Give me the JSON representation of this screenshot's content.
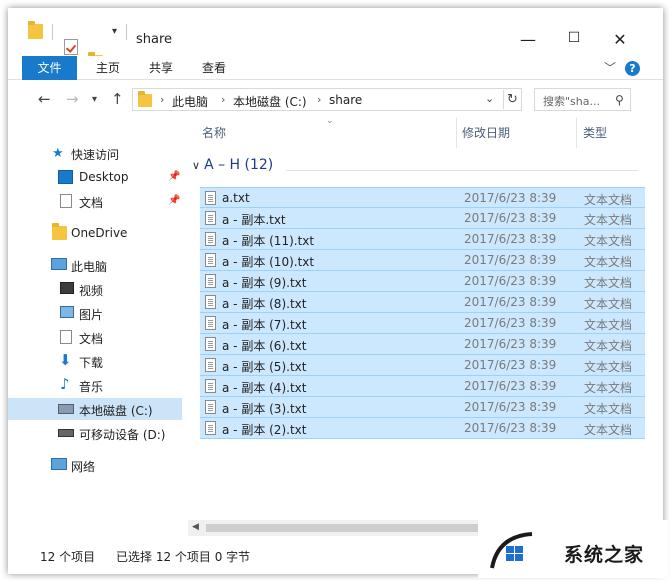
{
  "window": {
    "title": "share",
    "minimize_glyph": "—",
    "maximize_glyph": "☐",
    "close_glyph": "✕"
  },
  "ribbon": {
    "tabs": [
      {
        "label": "文件"
      },
      {
        "label": "主页"
      },
      {
        "label": "共享"
      },
      {
        "label": "查看"
      }
    ],
    "help_glyph": "?"
  },
  "address": {
    "crumbs": [
      "此电脑",
      "本地磁盘 (C:)",
      "share"
    ],
    "search_placeholder": "搜索\"sha...",
    "icons": {
      "back": "arrow-left-icon",
      "forward": "arrow-right-icon",
      "up": "arrow-up-icon",
      "refresh": "refresh-icon",
      "search": "search-icon"
    }
  },
  "sidebar": {
    "items": [
      {
        "label": "快速访问",
        "icon": "star-icon"
      },
      {
        "label": "Desktop",
        "icon": "desktop-icon",
        "pinned": true
      },
      {
        "label": "文档",
        "icon": "document-icon",
        "pinned": true
      },
      {
        "label": "OneDrive",
        "icon": "folder-icon"
      },
      {
        "label": "此电脑",
        "icon": "computer-icon"
      },
      {
        "label": "视频",
        "icon": "video-icon"
      },
      {
        "label": "图片",
        "icon": "picture-icon"
      },
      {
        "label": "文档",
        "icon": "document-icon"
      },
      {
        "label": "下载",
        "icon": "download-icon"
      },
      {
        "label": "音乐",
        "icon": "music-icon"
      },
      {
        "label": "本地磁盘 (C:)",
        "icon": "drive-icon",
        "selected": true
      },
      {
        "label": "可移动设备 (D:)",
        "icon": "removable-drive-icon"
      },
      {
        "label": "网络",
        "icon": "network-icon"
      }
    ]
  },
  "columns": {
    "name": "名称",
    "date": "修改日期",
    "type": "类型"
  },
  "group": {
    "title": "A – H (12)"
  },
  "files": [
    {
      "name": "a.txt",
      "date": "2017/6/23 8:39",
      "type": "文本文档"
    },
    {
      "name": "a - 副本.txt",
      "date": "2017/6/23 8:39",
      "type": "文本文档"
    },
    {
      "name": "a - 副本 (11).txt",
      "date": "2017/6/23 8:39",
      "type": "文本文档"
    },
    {
      "name": "a - 副本 (10).txt",
      "date": "2017/6/23 8:39",
      "type": "文本文档"
    },
    {
      "name": "a - 副本 (9).txt",
      "date": "2017/6/23 8:39",
      "type": "文本文档"
    },
    {
      "name": "a - 副本 (8).txt",
      "date": "2017/6/23 8:39",
      "type": "文本文档"
    },
    {
      "name": "a - 副本 (7).txt",
      "date": "2017/6/23 8:39",
      "type": "文本文档"
    },
    {
      "name": "a - 副本 (6).txt",
      "date": "2017/6/23 8:39",
      "type": "文本文档"
    },
    {
      "name": "a - 副本 (5).txt",
      "date": "2017/6/23 8:39",
      "type": "文本文档"
    },
    {
      "name": "a - 副本 (4).txt",
      "date": "2017/6/23 8:39",
      "type": "文本文档"
    },
    {
      "name": "a - 副本 (3).txt",
      "date": "2017/6/23 8:39",
      "type": "文本文档"
    },
    {
      "name": "a - 副本 (2).txt",
      "date": "2017/6/23 8:39",
      "type": "文本文档"
    }
  ],
  "status": {
    "count": "12 个项目",
    "selected": "已选择 12 个项目 0 字节"
  },
  "watermark": {
    "text": "系统之家"
  },
  "colors": {
    "accent": "#1979ca",
    "selection": "#cce8ff",
    "selection_border": "#99d1ff",
    "folder": "#f5c542"
  }
}
